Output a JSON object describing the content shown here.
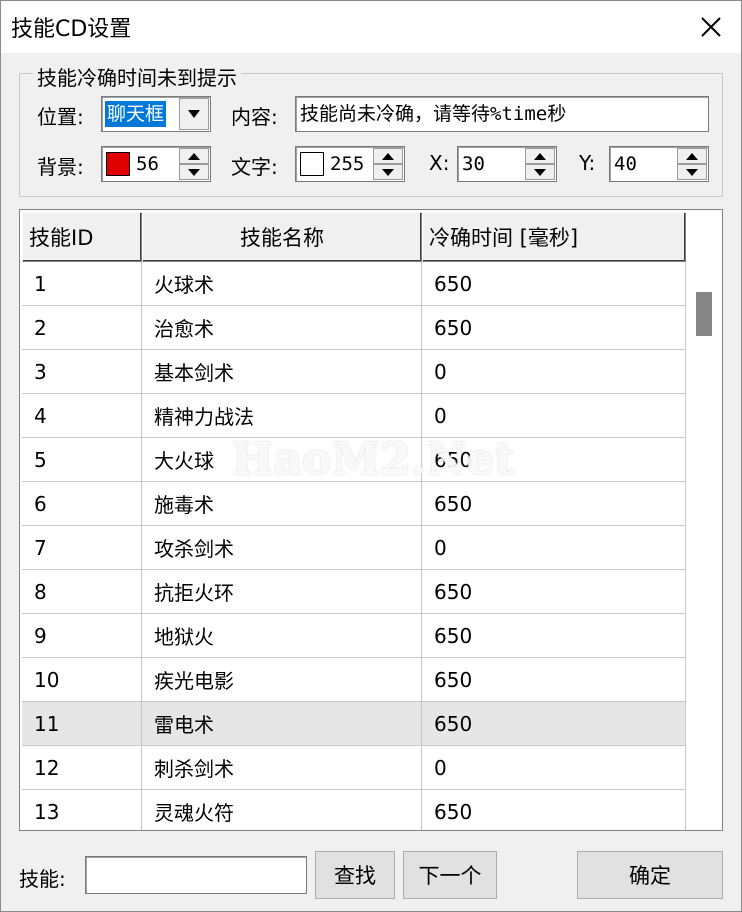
{
  "window": {
    "title": "技能CD设置"
  },
  "group": {
    "legend": "技能冷确时间未到提示",
    "position_label": "位置:",
    "position_value": "聊天框",
    "content_label": "内容:",
    "content_value": "技能尚未冷确，请等待%time秒",
    "bg_label": "背景:",
    "bg_color": "#e00000",
    "bg_value": "56",
    "text_label": "文字:",
    "text_color": "#ffffff",
    "text_value": "255",
    "x_label": "X:",
    "x_value": "30",
    "y_label": "Y:",
    "y_value": "40"
  },
  "table": {
    "headers": [
      "技能ID",
      "技能名称",
      "冷确时间 [毫秒]"
    ],
    "rows": [
      [
        "1",
        "火球术",
        "650"
      ],
      [
        "2",
        "治愈术",
        "650"
      ],
      [
        "3",
        "基本剑术",
        "0"
      ],
      [
        "4",
        "精神力战法",
        "0"
      ],
      [
        "5",
        "大火球",
        "650"
      ],
      [
        "6",
        "施毒术",
        "650"
      ],
      [
        "7",
        "攻杀剑术",
        "0"
      ],
      [
        "8",
        "抗拒火环",
        "650"
      ],
      [
        "9",
        "地狱火",
        "650"
      ],
      [
        "10",
        "疾光电影",
        "650"
      ],
      [
        "11",
        "雷电术",
        "650"
      ],
      [
        "12",
        "刺杀剑术",
        "0"
      ],
      [
        "13",
        "灵魂火符",
        "650"
      ]
    ],
    "selected_row": 10
  },
  "watermark": "HaoM2.Net",
  "footer": {
    "skill_label": "技能:",
    "search_value": "",
    "find_label": "查找",
    "next_label": "下一个",
    "ok_label": "确定"
  }
}
